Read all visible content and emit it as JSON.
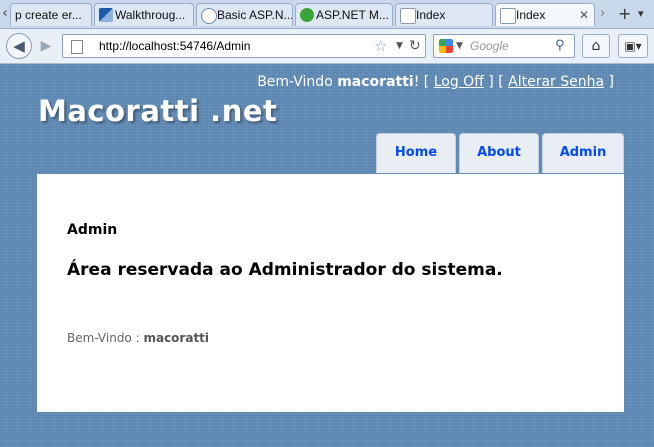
{
  "browser": {
    "tabs": [
      {
        "label": "p create er...",
        "favicon": "red-icon",
        "active": false
      },
      {
        "label": "Walkthroug...",
        "favicon": "visual-studio-icon",
        "active": false
      },
      {
        "label": "Basic ASP.N...",
        "favicon": "globe-icon",
        "active": false
      },
      {
        "label": "ASP.NET M...",
        "favicon": "green-circle-icon",
        "active": false
      },
      {
        "label": "Index",
        "favicon": "page-icon",
        "active": false
      },
      {
        "label": "Index",
        "favicon": "page-icon",
        "active": true
      }
    ],
    "url": "http://localhost:54746/Admin",
    "search_placeholder": "Google"
  },
  "site": {
    "title": "Macoratti .net",
    "login": {
      "greeting": "Bem-Vindo",
      "username": "macoratti",
      "exclaim": "!",
      "open_bracket_1": "[",
      "logoff_label": "Log Off",
      "close_bracket_1": "]",
      "open_bracket_2": "[",
      "change_password_label": "Alterar Senha",
      "close_bracket_2": "]"
    },
    "menu": [
      {
        "label": "Home"
      },
      {
        "label": "About"
      },
      {
        "label": "Admin"
      }
    ],
    "colors": {
      "page_bg": "#5c87b2",
      "menu_link": "#034af3",
      "menu_tab_bg": "#e8eef4"
    }
  },
  "main": {
    "section_label": "Admin",
    "heading": "Área reservada ao Administrador do sistema.",
    "welcome_prefix": "Bem-Vindo :",
    "welcome_user": "macoratti"
  }
}
